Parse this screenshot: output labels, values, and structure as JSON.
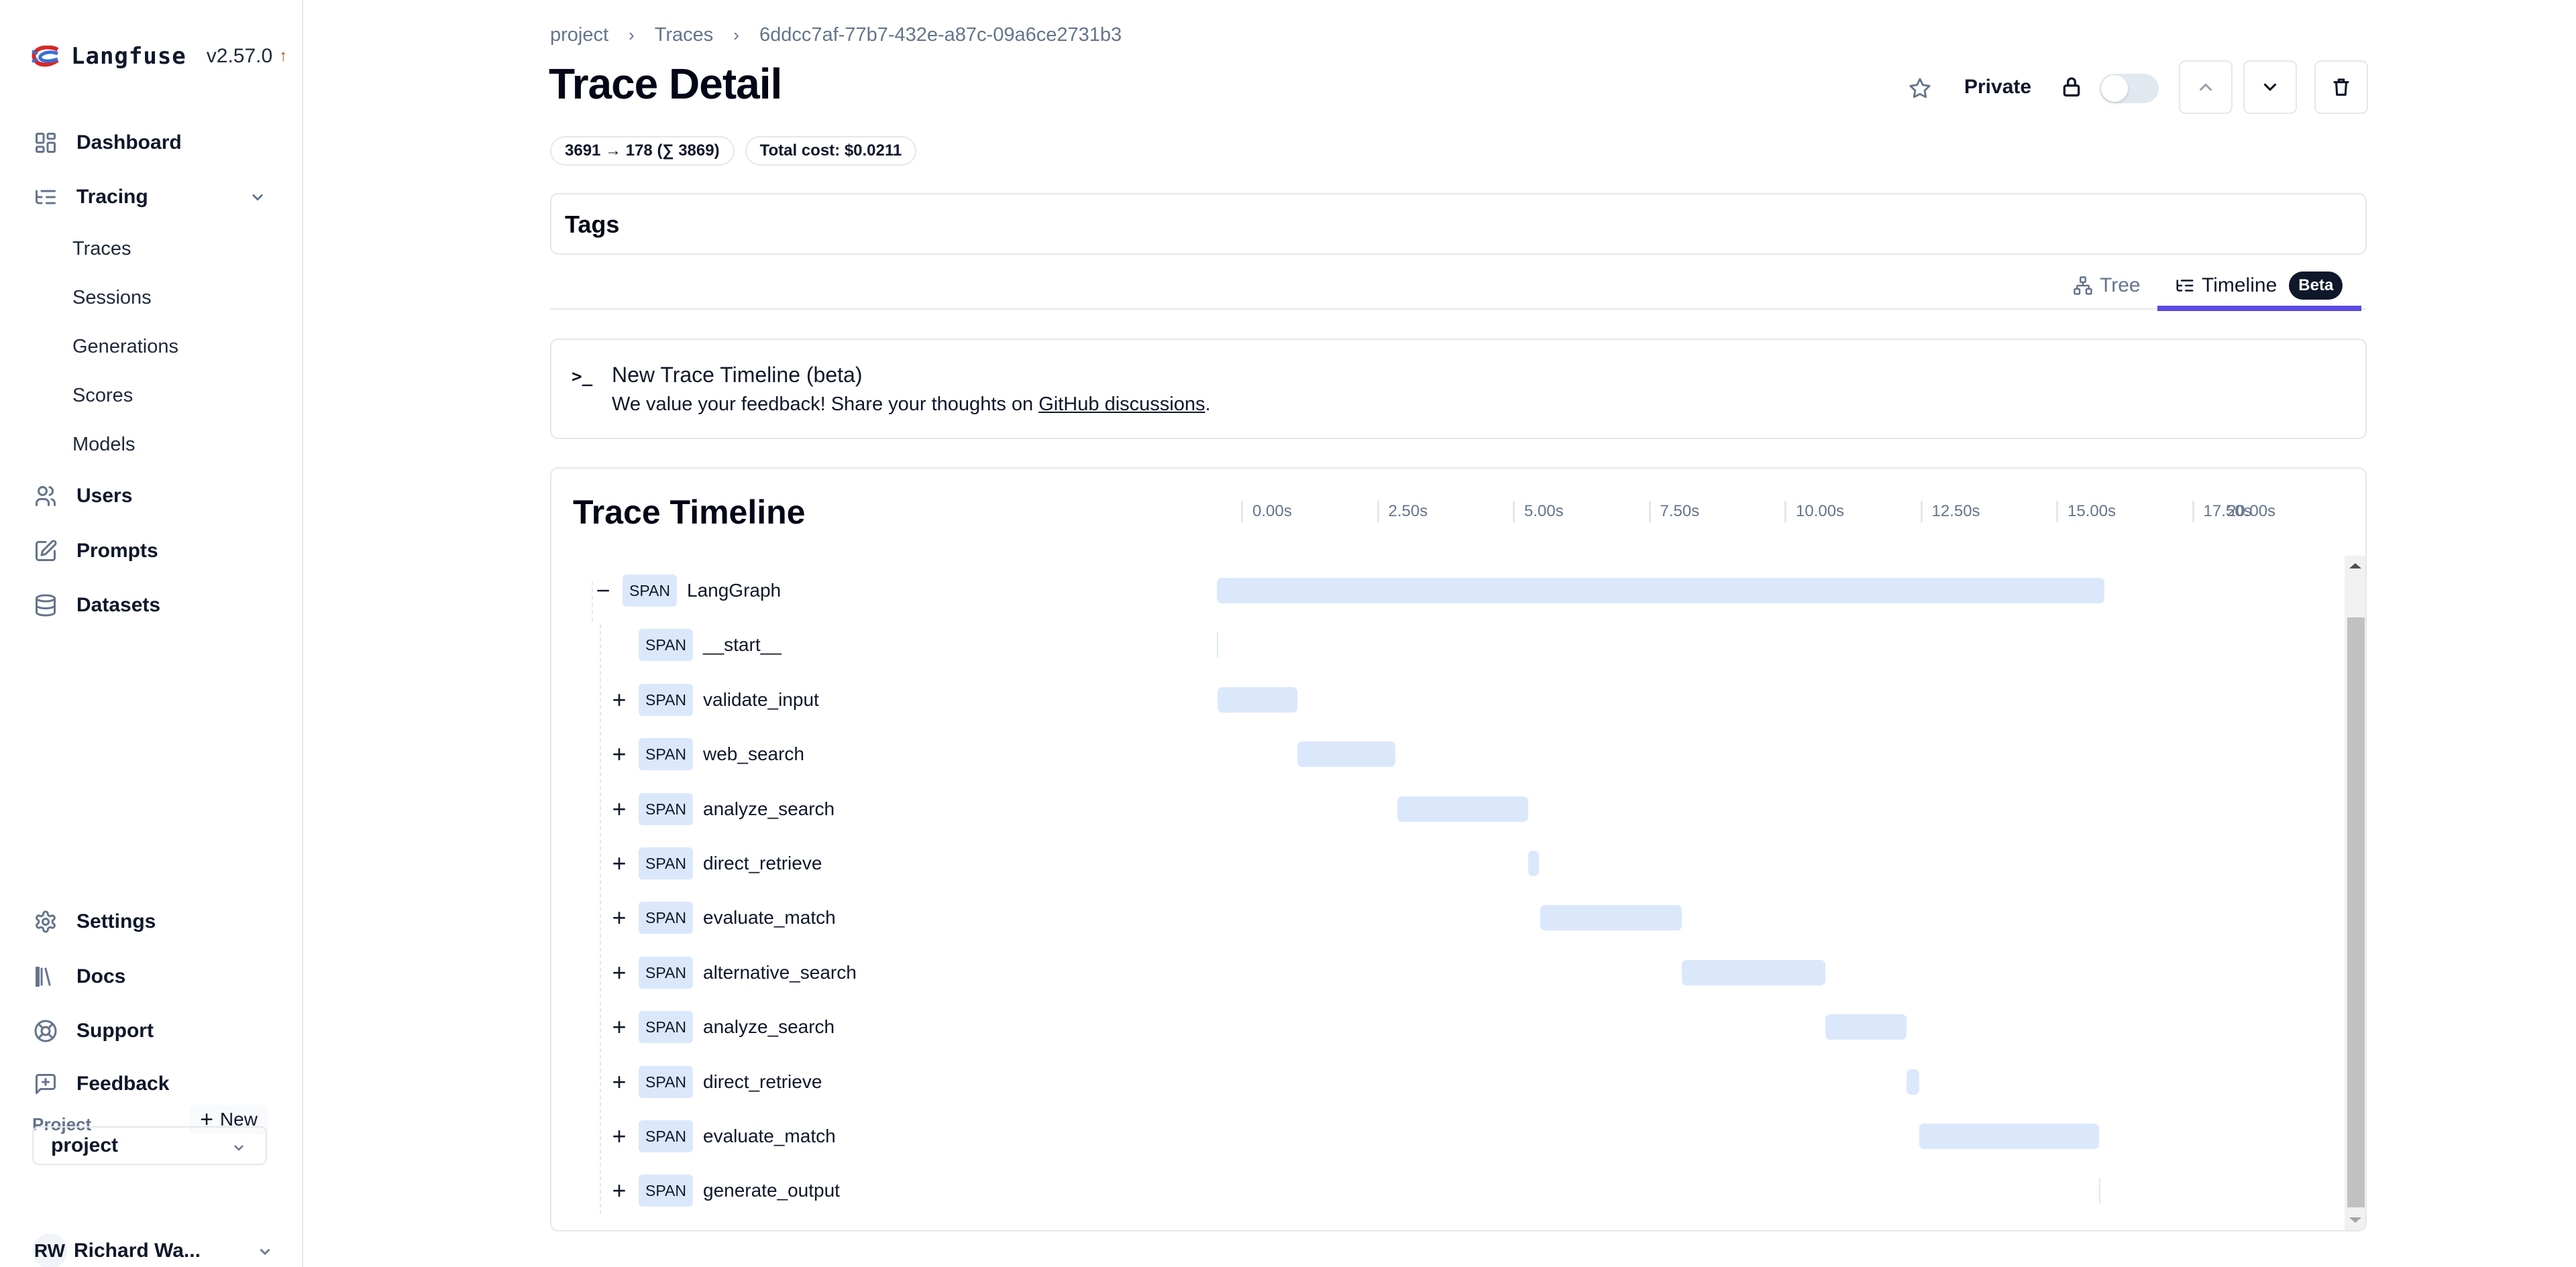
{
  "app": {
    "name": "Langfuse",
    "version": "v2.57.0",
    "update_indicator": "↑"
  },
  "sidebar": {
    "main_items": [
      {
        "label": "Dashboard",
        "icon": "layout-grid-icon"
      },
      {
        "label": "Tracing",
        "icon": "list-tree-icon",
        "expanded": true
      },
      {
        "label": "Users",
        "icon": "users-icon"
      },
      {
        "label": "Prompts",
        "icon": "edit-icon"
      },
      {
        "label": "Datasets",
        "icon": "database-icon"
      }
    ],
    "tracing_sub_items": [
      "Traces",
      "Sessions",
      "Generations",
      "Scores",
      "Models"
    ],
    "bottom_items": [
      {
        "label": "Settings",
        "icon": "gear-icon"
      },
      {
        "label": "Docs",
        "icon": "library-icon"
      },
      {
        "label": "Support",
        "icon": "lifebuoy-icon"
      },
      {
        "label": "Feedback",
        "icon": "message-plus-icon"
      }
    ],
    "project_label": "Project",
    "new_button": "New",
    "project_selected": "project",
    "user": {
      "initials": "RW",
      "name": "Richard Wa..."
    }
  },
  "breadcrumb": [
    "project",
    "Traces",
    "6ddcc7af-77b7-432e-a87c-09a6ce2731b3"
  ],
  "page_title": "Trace Detail",
  "badges": {
    "tokens": "3691 → 178 (∑ 3869)",
    "cost": "Total cost: $0.0211"
  },
  "header_actions": {
    "private_label": "Private",
    "private_toggle_on": false,
    "starred": false
  },
  "tags_card": {
    "title": "Tags"
  },
  "tabs": [
    {
      "label": "Tree",
      "active": false
    },
    {
      "label": "Timeline",
      "active": true,
      "badge": "Beta"
    }
  ],
  "notice": {
    "icon": ">_",
    "title": "New Trace Timeline (beta)",
    "body_prefix": "We value your feedback! Share your thoughts on ",
    "link_text": "GitHub discussions",
    "body_suffix": "."
  },
  "colors": {
    "accent_tab_underline": "#5b4ae0",
    "span_bar": "#dbe8fc",
    "beta_badge_bg": "#0f172a"
  },
  "chart_data": {
    "type": "gantt",
    "title": "Trace Timeline",
    "x_unit": "s",
    "x_ticks": [
      "0.00s",
      "2.50s",
      "5.00s",
      "7.50s",
      "10.00s",
      "12.50s",
      "15.00s",
      "17.50s",
      "20.00s"
    ],
    "x_range": [
      0,
      20
    ],
    "spans": [
      {
        "type": "SPAN",
        "name": "LangGraph",
        "depth": 0,
        "toggle": "−",
        "start": 0.0,
        "end": 16.33
      },
      {
        "type": "SPAN",
        "name": "__start__",
        "depth": 1,
        "toggle": "",
        "start": 0.0,
        "end": 0.01
      },
      {
        "type": "SPAN",
        "name": "validate_input",
        "depth": 1,
        "toggle": "+",
        "start": 0.01,
        "end": 1.48
      },
      {
        "type": "SPAN",
        "name": "web_search",
        "depth": 1,
        "toggle": "+",
        "start": 1.48,
        "end": 3.28
      },
      {
        "type": "SPAN",
        "name": "analyze_search",
        "depth": 1,
        "toggle": "+",
        "start": 3.32,
        "end": 5.73
      },
      {
        "type": "SPAN",
        "name": "direct_retrieve",
        "depth": 1,
        "toggle": "+",
        "start": 5.73,
        "end": 5.93
      },
      {
        "type": "SPAN",
        "name": "evaluate_match",
        "depth": 1,
        "toggle": "+",
        "start": 5.95,
        "end": 8.56
      },
      {
        "type": "SPAN",
        "name": "alternative_search",
        "depth": 1,
        "toggle": "+",
        "start": 8.56,
        "end": 11.2
      },
      {
        "type": "SPAN",
        "name": "analyze_search",
        "depth": 1,
        "toggle": "+",
        "start": 11.2,
        "end": 12.69
      },
      {
        "type": "SPAN",
        "name": "direct_retrieve",
        "depth": 1,
        "toggle": "+",
        "start": 12.69,
        "end": 12.93
      },
      {
        "type": "SPAN",
        "name": "evaluate_match",
        "depth": 1,
        "toggle": "+",
        "start": 12.93,
        "end": 16.23
      },
      {
        "type": "SPAN",
        "name": "generate_output",
        "depth": 1,
        "toggle": "+",
        "start": 16.24,
        "end": 16.25
      }
    ]
  }
}
